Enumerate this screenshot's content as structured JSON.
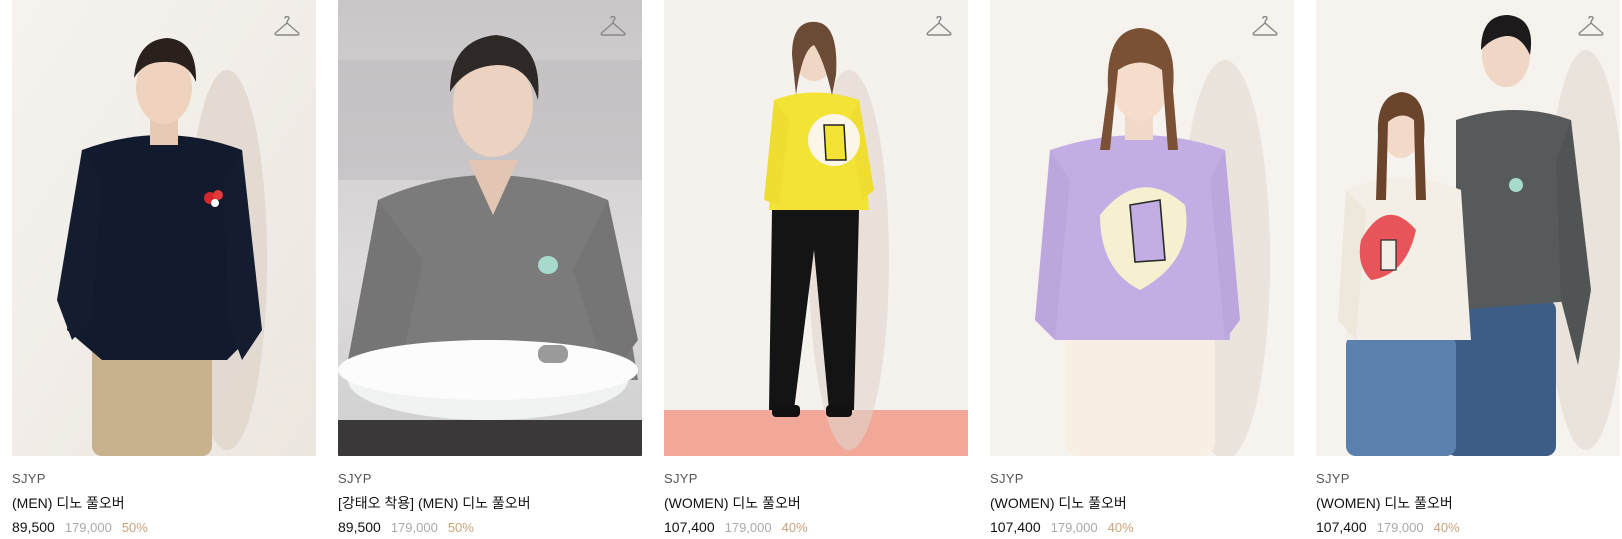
{
  "colors": {
    "discount": "#c9a27a",
    "original_price": "#aaaaaa",
    "text": "#111111"
  },
  "products": [
    {
      "brand": "SJYP",
      "name": "(MEN) 디노 풀오버",
      "price": "89,500",
      "original_price": "179,000",
      "discount": "50%",
      "photo": "man in navy sweater with red dino heart patch, beige trousers",
      "icon": "hanger-icon"
    },
    {
      "brand": "SJYP",
      "name": "[강태오 착용] (MEN) 디노 풀오버",
      "price": "89,500",
      "original_price": "179,000",
      "discount": "50%",
      "photo": "man in grey v-neck sweater with mint dino patch holding white cushion",
      "icon": "hanger-icon"
    },
    {
      "brand": "SJYP",
      "name": "(WOMEN) 디노 풀오버",
      "price": "107,400",
      "original_price": "179,000",
      "discount": "40%",
      "photo": "woman in yellow sweater with dino graphic, black trousers",
      "icon": "hanger-icon"
    },
    {
      "brand": "SJYP",
      "name": "(WOMEN) 디노 풀오버",
      "price": "107,400",
      "original_price": "179,000",
      "discount": "40%",
      "photo": "woman in lavender sweater with dino graphic, white trousers",
      "icon": "hanger-icon"
    },
    {
      "brand": "SJYP",
      "name": "(WOMEN) 디노 풀오버",
      "price": "107,400",
      "original_price": "179,000",
      "discount": "40%",
      "photo": "couple in white dino sweater and grey sweater with jeans",
      "icon": "hanger-icon"
    }
  ]
}
